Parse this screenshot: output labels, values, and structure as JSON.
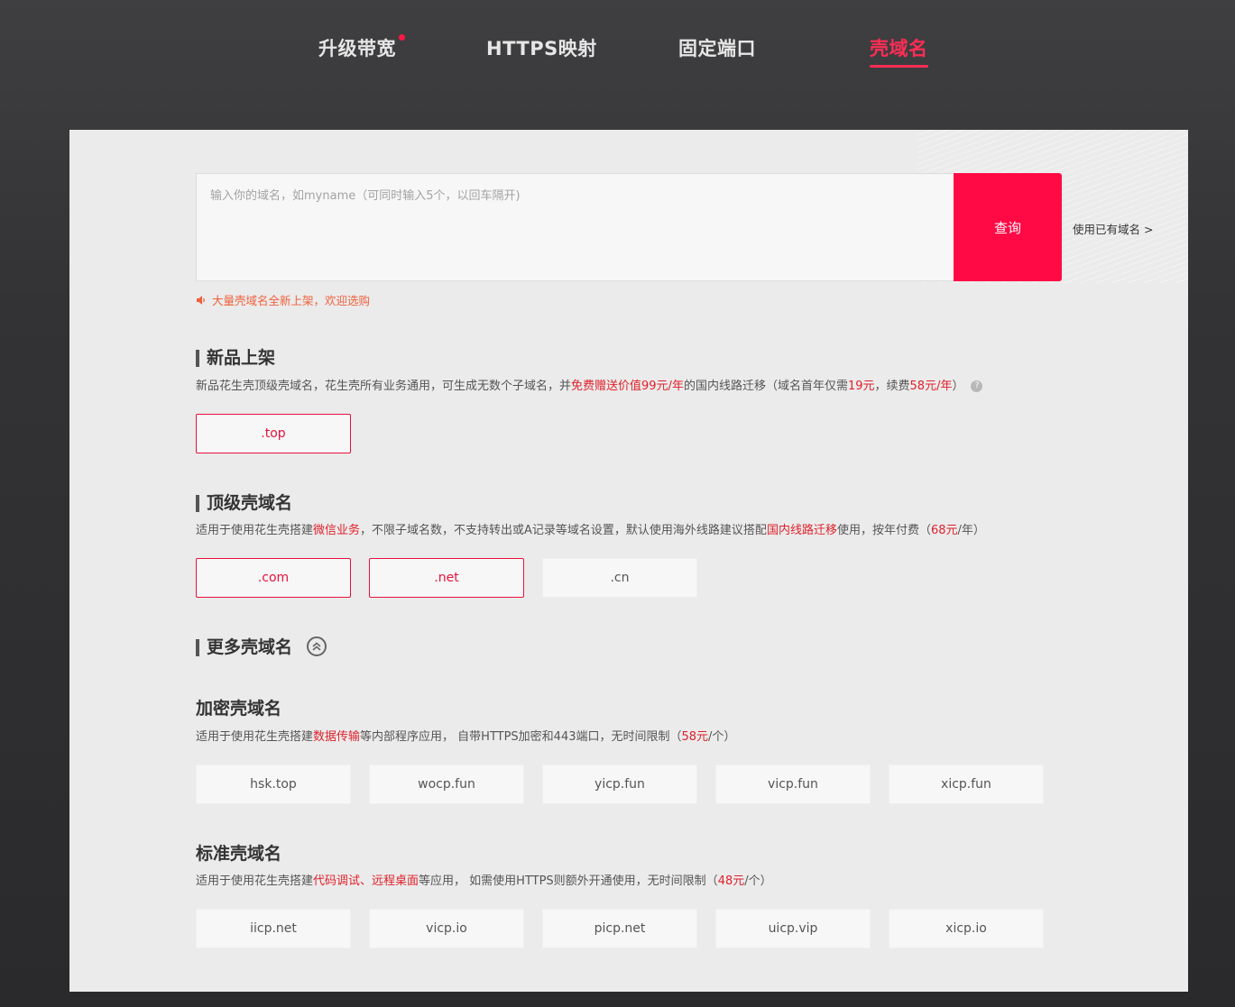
{
  "tabs": [
    {
      "label": "升级带宽",
      "active": false,
      "has_dot": true
    },
    {
      "label": "HTTPS映射",
      "active": false
    },
    {
      "label": "固定端口",
      "active": false
    },
    {
      "label": "壳域名",
      "active": true
    }
  ],
  "search": {
    "placeholder": "输入你的域名，如myname（可同时输入5个，以回车隔开)",
    "button_label": "查询",
    "own_domain_link": "使用已有域名 >",
    "notice": "大量壳域名全新上架，欢迎选购"
  },
  "new_products": {
    "title": "新品上架",
    "desc_parts": [
      {
        "text": "新品花生壳顶级壳域名，花生壳所有业务通用，可生成无数个子域名，并",
        "red": false
      },
      {
        "text": "免费赠送价值99元/年",
        "red": true
      },
      {
        "text": "的国内线路迁移（域名首年仅需",
        "red": false
      },
      {
        "text": "19元",
        "red": true
      },
      {
        "text": "，续费",
        "red": false
      },
      {
        "text": "58元/年",
        "red": true
      },
      {
        "text": "）",
        "red": false
      }
    ],
    "help_icon": "?",
    "chips": [
      {
        "label": ".top",
        "selected": true
      }
    ]
  },
  "top_level": {
    "title": "顶级壳域名",
    "desc_parts": [
      {
        "text": "适用于使用花生壳搭建",
        "red": false
      },
      {
        "text": "微信业务",
        "red": true
      },
      {
        "text": "，不限子域名数，不支持转出或A记录等域名设置，默认使用海外线路建议搭配",
        "red": false
      },
      {
        "text": "国内线路迁移",
        "red": true
      },
      {
        "text": "使用，按年付费（",
        "red": false
      },
      {
        "text": "68元",
        "red": true
      },
      {
        "text": "/年）",
        "red": false
      }
    ],
    "chips": [
      {
        "label": ".com",
        "selected": true
      },
      {
        "label": ".net",
        "selected": true
      },
      {
        "label": ".cn",
        "selected": false
      }
    ]
  },
  "more": {
    "title": "更多壳域名"
  },
  "encrypted": {
    "title": "加密壳域名",
    "desc_parts": [
      {
        "text": "适用于使用花生壳搭建",
        "red": false
      },
      {
        "text": "数据传输",
        "red": true
      },
      {
        "text": "等内部程序应用， 自带HTTPS加密和443端口，无时间限制（",
        "red": false
      },
      {
        "text": "58元",
        "red": true
      },
      {
        "text": "/个）",
        "red": false
      }
    ],
    "chips": [
      {
        "label": "hsk.top",
        "selected": false
      },
      {
        "label": "wocp.fun",
        "selected": false
      },
      {
        "label": "yicp.fun",
        "selected": false
      },
      {
        "label": "vicp.fun",
        "selected": false
      },
      {
        "label": "xicp.fun",
        "selected": false
      }
    ]
  },
  "standard": {
    "title": "标准壳域名",
    "desc_parts": [
      {
        "text": "适用于使用花生壳搭建",
        "red": false
      },
      {
        "text": "代码调试、远程桌面",
        "red": true
      },
      {
        "text": "等应用， 如需使用HTTPS则额外开通使用，无时间限制（",
        "red": false
      },
      {
        "text": "48元",
        "red": true
      },
      {
        "text": "/个）",
        "red": false
      }
    ],
    "chips": [
      {
        "label": "iicp.net",
        "selected": false
      },
      {
        "label": "vicp.io",
        "selected": false
      },
      {
        "label": "picp.net",
        "selected": false
      },
      {
        "label": "uicp.vip",
        "selected": false
      },
      {
        "label": "xicp.io",
        "selected": false
      }
    ]
  },
  "colors": {
    "accent": "#ff0a45",
    "selected_border": "#e8123c",
    "notice": "#f0603c"
  }
}
